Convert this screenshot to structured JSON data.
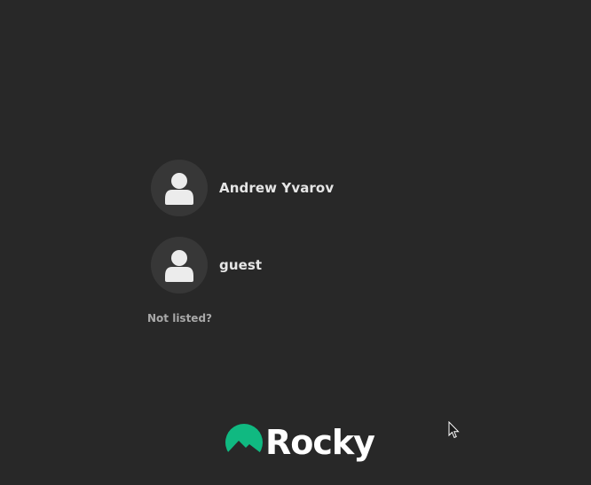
{
  "users": [
    {
      "name": "Andrew Yvarov",
      "avatar_icon": "person-icon"
    },
    {
      "name": "guest",
      "avatar_icon": "person-icon"
    }
  ],
  "not_listed_label": "Not listed?",
  "brand": {
    "logo_icon": "rocky-logo-icon",
    "wordmark": "Rocky",
    "logo_color": "#10b981"
  },
  "colors": {
    "background": "#282828",
    "avatar_background": "#373737",
    "text_primary": "#e6e6e6",
    "text_secondary": "#a8a8a8"
  }
}
